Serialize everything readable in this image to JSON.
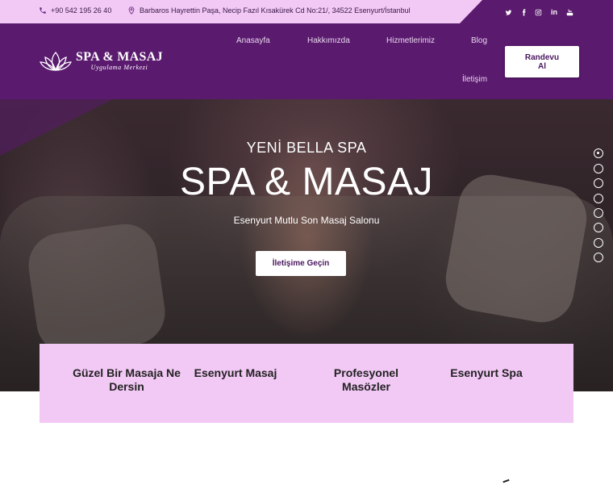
{
  "topbar": {
    "phone": "+90 542 195 26 40",
    "address": "Barbaros Hayrettin Paşa, Necip Fazıl Kısakürek Cd No:21/, 34522 Esenyurt/İstanbul",
    "social": [
      {
        "icon": "twitter-icon"
      },
      {
        "icon": "facebook-icon"
      },
      {
        "icon": "instagram-icon"
      },
      {
        "icon": "linkedin-icon",
        "label": "in"
      },
      {
        "icon": "youtube-icon"
      }
    ]
  },
  "header": {
    "logo_title": "SPA & MASAJ",
    "logo_subtitle": "Uygulama Merkezi",
    "nav": [
      "Anasayfa",
      "Hakkımızda",
      "Hizmetlerimiz",
      "Blog",
      "İletişim"
    ],
    "cta_line1": "Randevu",
    "cta_line2": "Al"
  },
  "hero": {
    "subtitle": "YENİ BELLA SPA",
    "title": "SPA & MASAJ",
    "description": "Esenyurt Mutlu Son Masaj Salonu",
    "button": "İletişime Geçin",
    "slide_count": 8,
    "active_slide": 1
  },
  "features": [
    "Güzel Bir Masaja Ne Dersin",
    "Esenyurt Masaj",
    "Profesyonel Masözler",
    "Esenyurt Spa"
  ],
  "colors": {
    "brand_purple": "#5a1a6e",
    "light_pink": "#f2c8f5",
    "white": "#ffffff"
  }
}
